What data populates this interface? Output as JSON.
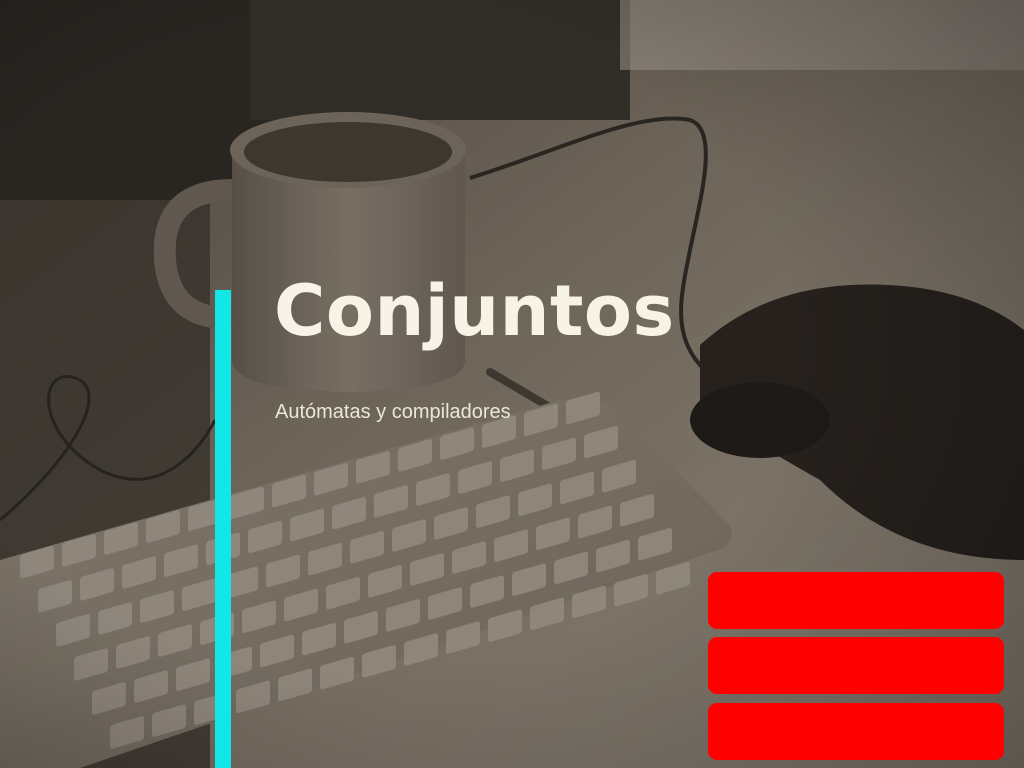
{
  "slide": {
    "title": "Conjuntos",
    "subtitle": "Autómatas y compiladores"
  },
  "background": {
    "description_icon": "desk-keyboard-mug-photo"
  },
  "colors": {
    "accent": "#12e6e6",
    "block": "#ff0000",
    "title": "#f7f3e6",
    "subtitle": "#ece6d8"
  },
  "blocks": [
    {
      "label": ""
    },
    {
      "label": ""
    },
    {
      "label": ""
    }
  ]
}
